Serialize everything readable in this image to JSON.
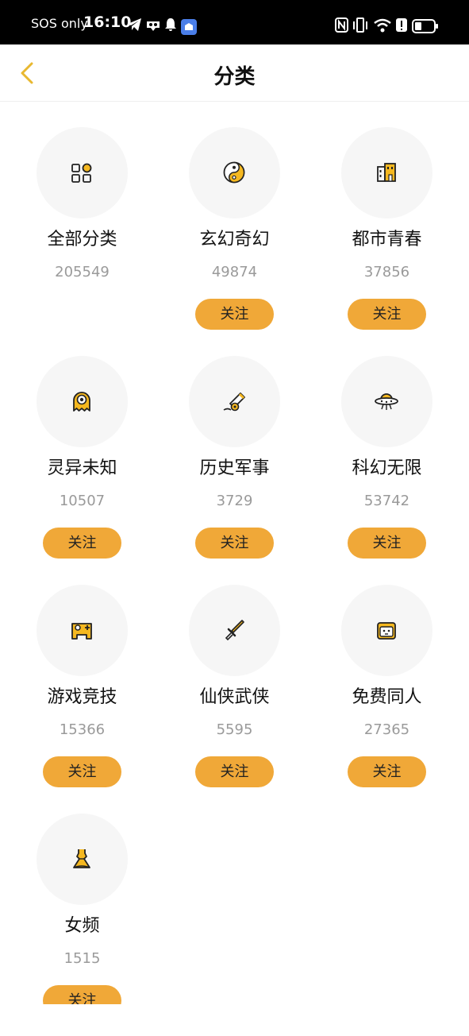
{
  "status_bar": {
    "carrier": "SOS only",
    "time": "16:10"
  },
  "header": {
    "title": "分类"
  },
  "colors": {
    "accent": "#f0a838",
    "icon_yellow": "#f5b820",
    "back_arrow": "#e8b830"
  },
  "categories": [
    {
      "name": "全部分类",
      "count": "205549",
      "icon": "grid-icon",
      "follow_label": ""
    },
    {
      "name": "玄幻奇幻",
      "count": "49874",
      "icon": "yin-yang-icon",
      "follow_label": "关注"
    },
    {
      "name": "都市青春",
      "count": "37856",
      "icon": "building-icon",
      "follow_label": "关注"
    },
    {
      "name": "灵异未知",
      "count": "10507",
      "icon": "ghost-icon",
      "follow_label": "关注"
    },
    {
      "name": "历史军事",
      "count": "3729",
      "icon": "cannon-icon",
      "follow_label": "关注"
    },
    {
      "name": "科幻无限",
      "count": "53742",
      "icon": "ufo-icon",
      "follow_label": "关注"
    },
    {
      "name": "游戏竞技",
      "count": "15366",
      "icon": "gamepad-icon",
      "follow_label": "关注"
    },
    {
      "name": "仙侠武侠",
      "count": "5595",
      "icon": "sword-icon",
      "follow_label": "关注"
    },
    {
      "name": "免费同人",
      "count": "27365",
      "icon": "face-icon",
      "follow_label": "关注"
    },
    {
      "name": "女频",
      "count": "1515",
      "icon": "dress-icon",
      "follow_label": "关注"
    }
  ]
}
